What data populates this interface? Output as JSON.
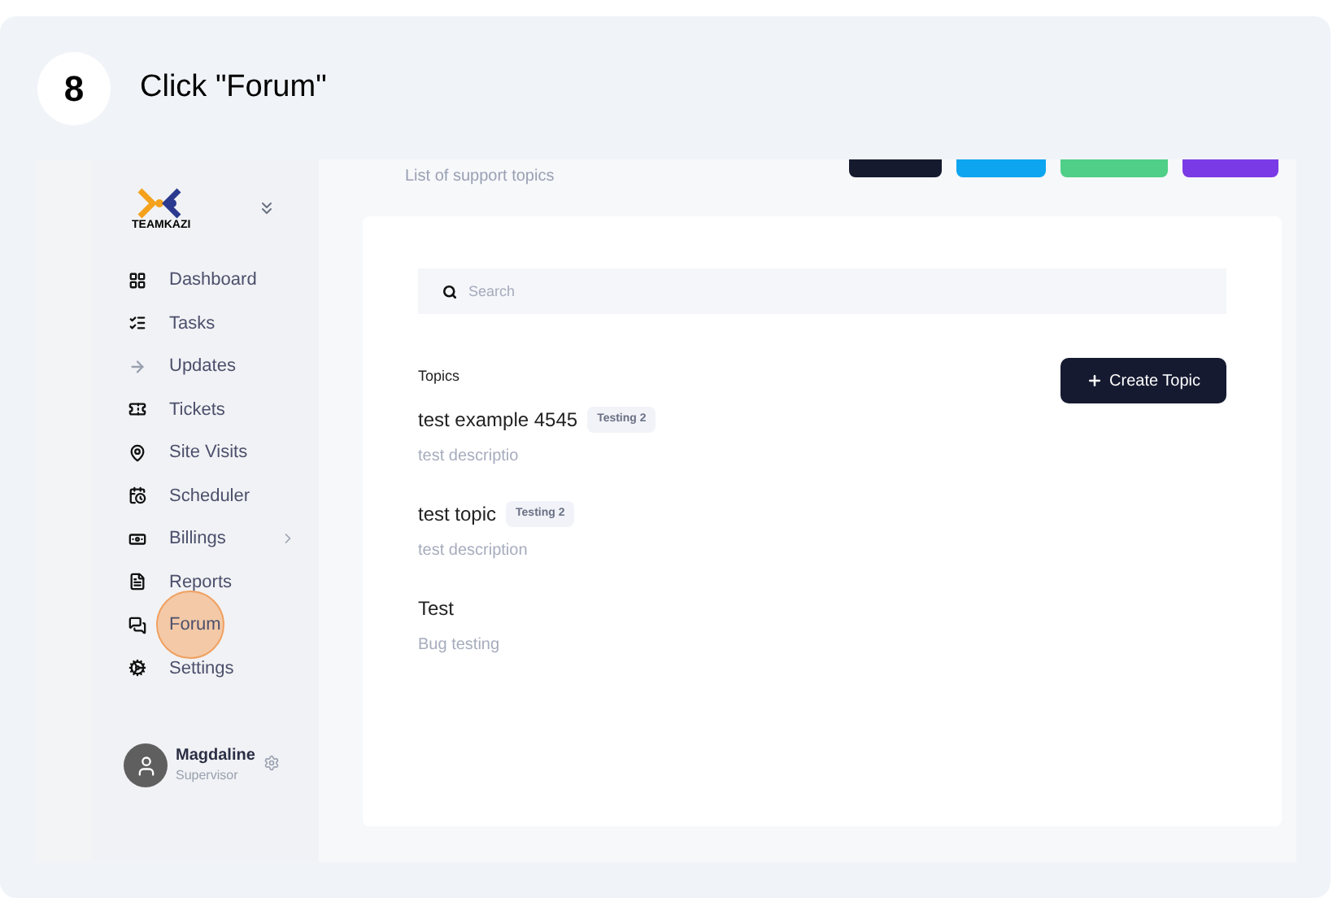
{
  "step": {
    "number": "8",
    "instruction": "Click \"Forum\""
  },
  "sidebar": {
    "logo_text": "TEAMKAZI",
    "items": [
      {
        "label": "Dashboard",
        "expandable": false,
        "highlighted": false
      },
      {
        "label": "Tasks",
        "expandable": false,
        "highlighted": false
      },
      {
        "label": "Updates",
        "expandable": false,
        "highlighted": false
      },
      {
        "label": "Tickets",
        "expandable": false,
        "highlighted": false
      },
      {
        "label": "Site Visits",
        "expandable": false,
        "highlighted": false
      },
      {
        "label": "Scheduler",
        "expandable": false,
        "highlighted": false
      },
      {
        "label": "Billings",
        "expandable": true,
        "highlighted": false
      },
      {
        "label": "Reports",
        "expandable": false,
        "highlighted": false
      },
      {
        "label": "Forum",
        "expandable": false,
        "highlighted": true
      },
      {
        "label": "Settings",
        "expandable": false,
        "highlighted": false
      }
    ],
    "user": {
      "name": "Magdaline",
      "role": "Supervisor"
    }
  },
  "header": {
    "subtitle": "List of support topics",
    "quick_buttons": [
      {
        "color": "#161a2e"
      },
      {
        "color": "#0ea5f0"
      },
      {
        "color": "#4fcf87"
      },
      {
        "color": "#7a3be6"
      }
    ]
  },
  "search": {
    "placeholder": "Search"
  },
  "topics": {
    "heading": "Topics",
    "create_button": "Create Topic",
    "items": [
      {
        "title": "test example 4545",
        "tag": "Testing 2",
        "description": "test descriptio"
      },
      {
        "title": "test topic",
        "tag": "Testing 2",
        "description": "test description"
      },
      {
        "title": "Test",
        "description": "Bug testing"
      }
    ]
  }
}
